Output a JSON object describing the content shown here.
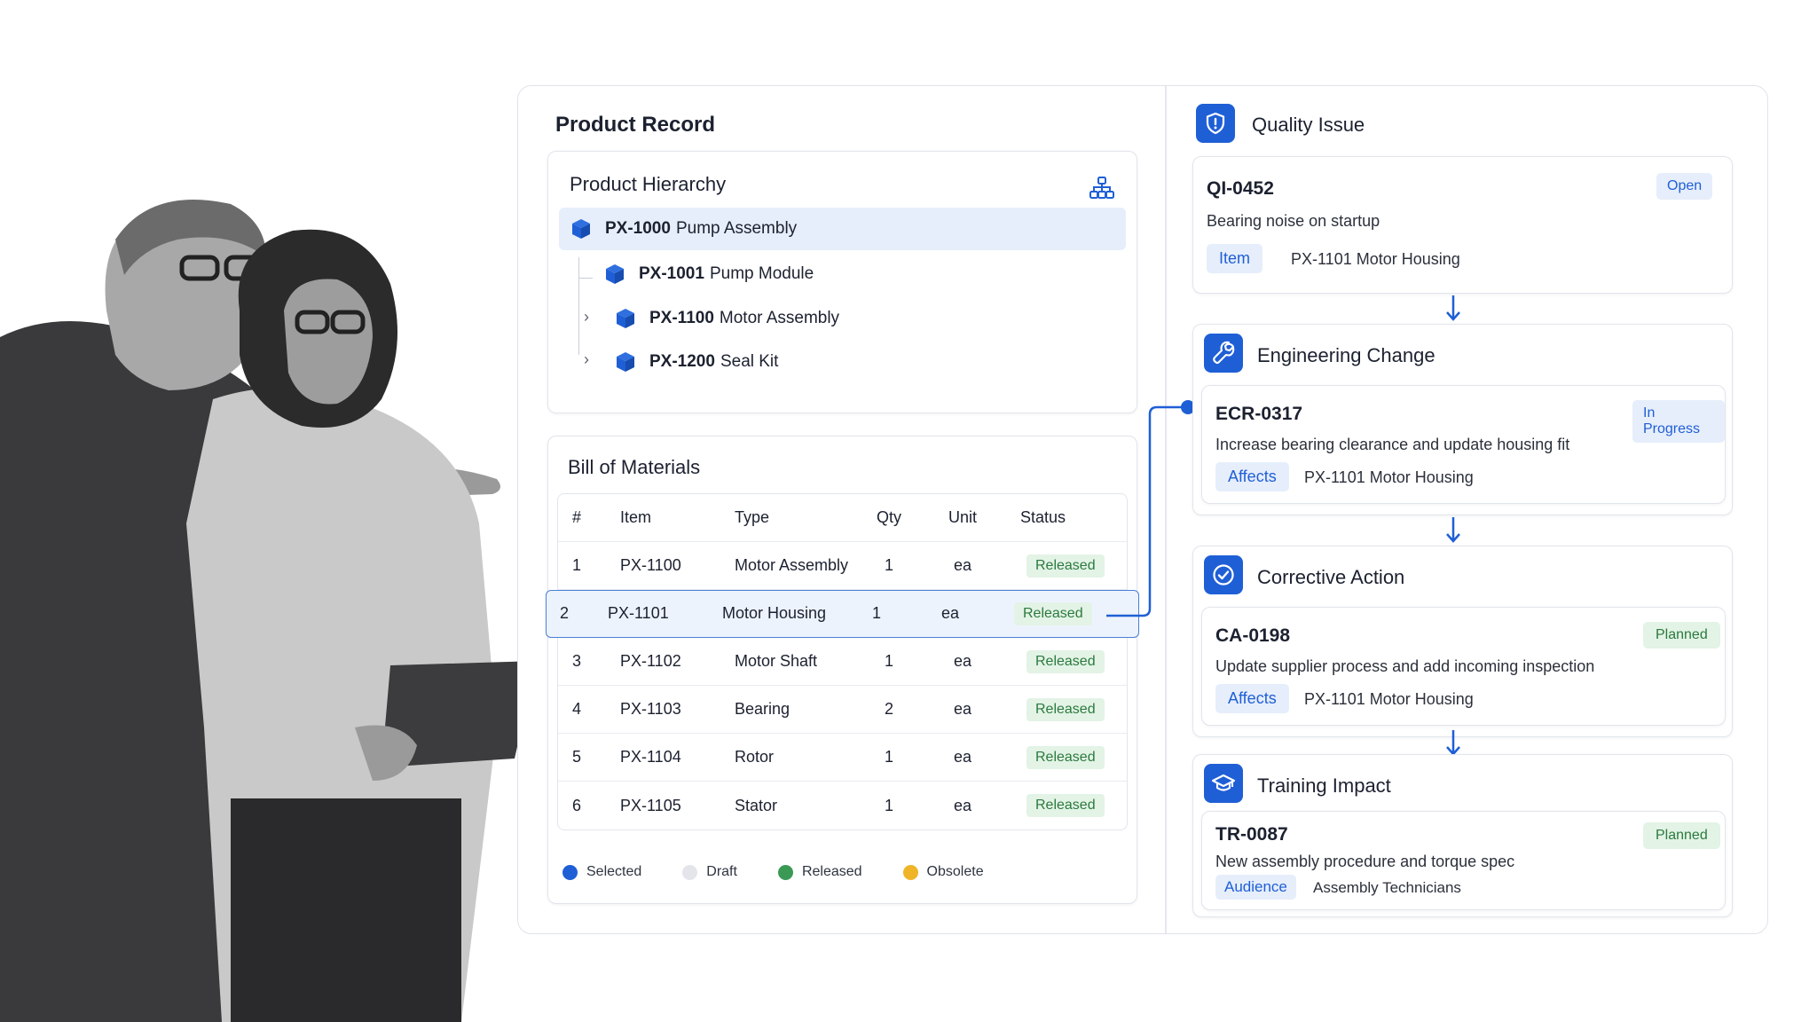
{
  "product_record": {
    "title": "Product Record",
    "hierarchy": {
      "title": "Product Hierarchy",
      "items": [
        {
          "code": "PX-1000",
          "name": "Pump Assembly"
        },
        {
          "code": "PX-1001",
          "name": "Pump Module"
        },
        {
          "code": "PX-1100",
          "name": "Motor Assembly"
        },
        {
          "code": "PX-1200",
          "name": "Seal Kit"
        }
      ]
    },
    "bom": {
      "title": "Bill of Materials",
      "columns": [
        "#",
        "Item",
        "Type",
        "Qty",
        "Unit",
        "Status"
      ],
      "rows": [
        {
          "num": "1",
          "item": "PX-1100",
          "type": "Motor Assembly",
          "qty": "1",
          "unit": "ea",
          "status": "Released"
        },
        {
          "num": "2",
          "item": "PX-1101",
          "type": "Motor Housing",
          "qty": "1",
          "unit": "ea",
          "status": "Released"
        },
        {
          "num": "3",
          "item": "PX-1102",
          "type": "Motor Shaft",
          "qty": "1",
          "unit": "ea",
          "status": "Released"
        },
        {
          "num": "4",
          "item": "PX-1103",
          "type": "Bearing",
          "qty": "2",
          "unit": "ea",
          "status": "Released"
        },
        {
          "num": "5",
          "item": "PX-1104",
          "type": "Rotor",
          "qty": "1",
          "unit": "ea",
          "status": "Released"
        },
        {
          "num": "6",
          "item": "PX-1105",
          "type": "Stator",
          "qty": "1",
          "unit": "ea",
          "status": "Released"
        }
      ],
      "legend": [
        {
          "label": "Selected",
          "color": "#1f5fd6"
        },
        {
          "label": "Draft",
          "color": "#e3e5ea"
        },
        {
          "label": "Released",
          "color": "#3a9a55"
        },
        {
          "label": "Obsolete",
          "color": "#f0b429"
        }
      ]
    }
  },
  "quality_issue": {
    "title": "Quality Issue",
    "icon": "shield-alert-icon",
    "code": "QI-0452",
    "status": "Open",
    "description": "Bearing noise on startup",
    "tag": "Item",
    "tag_value": "PX-1101 Motor Housing"
  },
  "engineering_change": {
    "title": "Engineering Change",
    "icon": "wrench-icon",
    "code": "ECR-0317",
    "status": "In Progress",
    "description": "Increase bearing clearance and update housing fit",
    "tag": "Affects",
    "tag_value": "PX-1101 Motor Housing"
  },
  "corrective_action": {
    "title": "Corrective Action",
    "icon": "check-circle-icon",
    "code": "CA-0198",
    "status": "Planned",
    "description": "Update supplier process and add incoming inspection",
    "tag": "Affects",
    "tag_value": "PX-1101 Motor Housing"
  },
  "training_impact": {
    "title": "Training Impact",
    "icon": "graduation-cap-icon",
    "code": "TR-0087",
    "status": "Planned",
    "description": "New assembly procedure and torque spec",
    "tag": "Audience",
    "tag_value": "Assembly Technicians"
  },
  "colors": {
    "accent": "#1f5fd6",
    "released_bg": "#e3f3e6",
    "released_text": "#2b7a3d",
    "tag_bg": "#e6eefb"
  }
}
